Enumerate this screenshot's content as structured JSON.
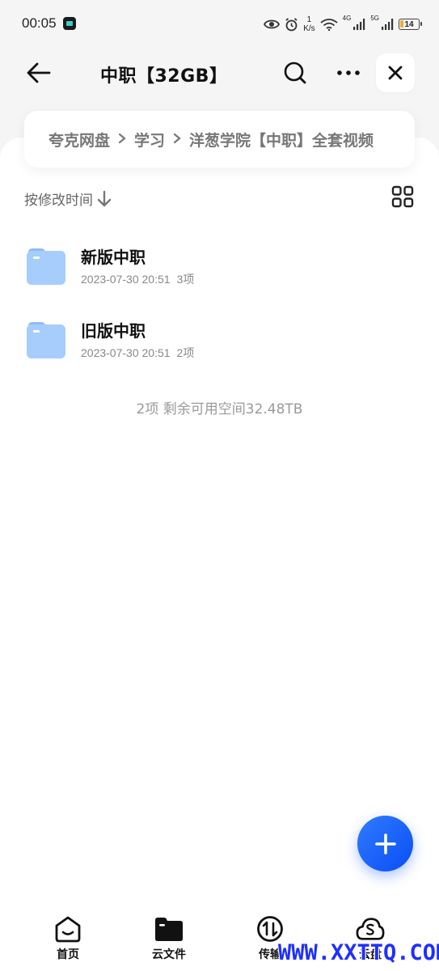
{
  "status_bar": {
    "time": "00:05",
    "net_speed_value": "1",
    "net_speed_unit": "K/s",
    "sim1_label": "4G",
    "sim2_label": "5G",
    "battery_level": "14"
  },
  "header": {
    "title": "中职【32GB】"
  },
  "breadcrumb": [
    {
      "label": "夸克网盘"
    },
    {
      "label": "学习"
    },
    {
      "label": "洋葱学院【中职】全套视频"
    }
  ],
  "sort": {
    "label": "按修改时间"
  },
  "files": [
    {
      "name": "新版中职",
      "date": "2023-07-30 20:51",
      "count": "3项"
    },
    {
      "name": "旧版中职",
      "date": "2023-07-30 20:51",
      "count": "2项"
    }
  ],
  "summary": "2项 剩余可用空间32.48TB",
  "bottom_nav": [
    {
      "label": "首页",
      "icon": "home-icon"
    },
    {
      "label": "云文件",
      "icon": "folder-icon"
    },
    {
      "label": "传输",
      "icon": "transfer-icon"
    },
    {
      "label": "云盘",
      "icon": "cloud-icon"
    }
  ],
  "watermark": "WWW.XXTTQ.COM",
  "colors": {
    "accent": "#1f5cff",
    "folder": "#9cc8fb"
  }
}
